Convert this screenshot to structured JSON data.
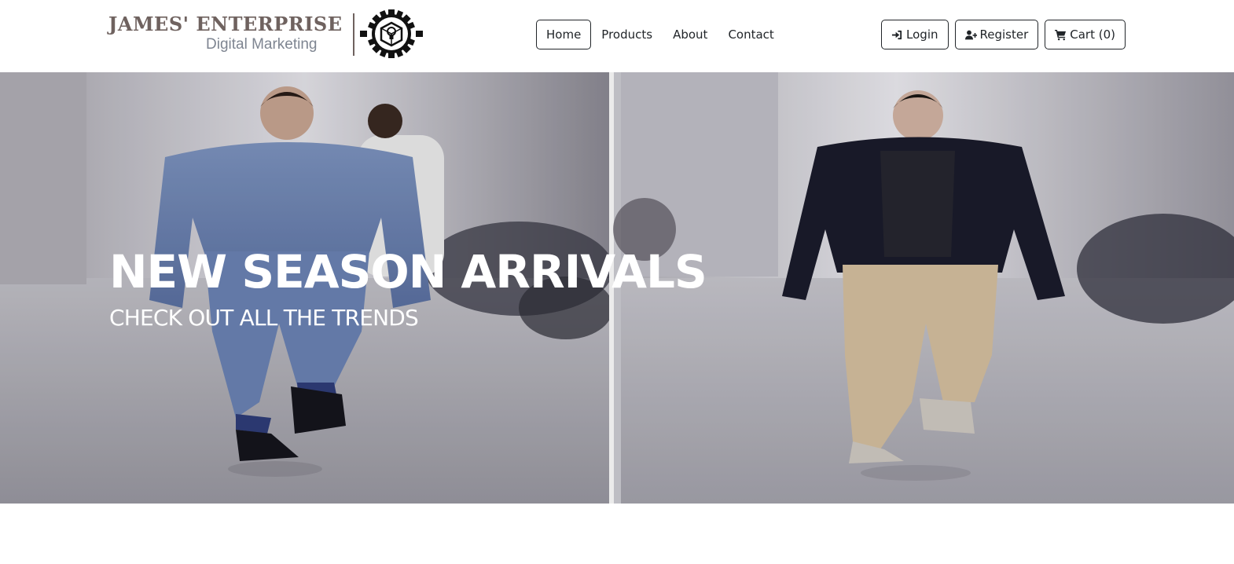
{
  "brand": {
    "name": "JAMES' ENTERPRISE",
    "tagline": "Digital Marketing",
    "logo_icon": "gear-lightbulb-cube-icon"
  },
  "nav": {
    "links": [
      {
        "label": "Home",
        "active": true
      },
      {
        "label": "Products",
        "active": false
      },
      {
        "label": "About",
        "active": false
      },
      {
        "label": "Contact",
        "active": false
      }
    ]
  },
  "actions": {
    "login": {
      "label": "Login",
      "icon": "sign-in-icon"
    },
    "register": {
      "label": "Register",
      "icon": "user-plus-icon"
    },
    "cart": {
      "label": "Cart (0)",
      "icon": "shopping-cart-icon"
    }
  },
  "hero": {
    "title": "NEW SEASON ARRIVALS",
    "subtitle": "CHECK OUT ALL THE TRENDS",
    "image_description_icon": "runway-models-photo"
  },
  "colors": {
    "brand_text": "#6f625f",
    "brand_tagline": "#7e8591",
    "nav_text": "#212529",
    "hero_text": "#ffffff"
  }
}
